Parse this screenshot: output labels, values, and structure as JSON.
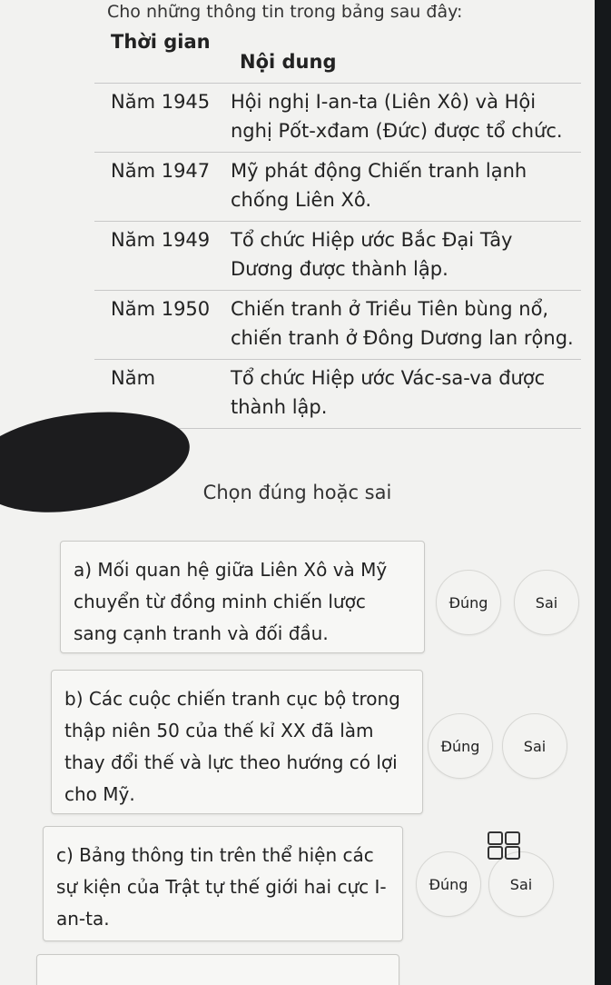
{
  "intro_text": "Cho những thông tin trong bảng sau đây:",
  "table": {
    "headers": [
      "Thời gian",
      "Nội dung"
    ],
    "rows": [
      {
        "year": "Năm 1945",
        "content": "Hội nghị I-an-ta (Liên Xô) và Hội nghị Pốt-xđam (Đức) được tổ chức."
      },
      {
        "year": "Năm 1947",
        "content": "Mỹ phát động Chiến tranh lạnh chống Liên Xô."
      },
      {
        "year": "Năm 1949",
        "content": "Tổ chức Hiệp ước Bắc Đại Tây Dương được thành lập."
      },
      {
        "year": "Năm 1950",
        "content": "Chiến tranh ở Triều Tiên bùng nổ, chiến tranh ở Đông Dương lan rộng."
      },
      {
        "year": "Năm",
        "content": "Tổ chức Hiệp ước Vác-sa-va được thành lập."
      }
    ]
  },
  "section_heading": "Chọn đúng hoặc sai",
  "questions": [
    {
      "text": "a) Mối quan hệ giữa Liên Xô và Mỹ chuyển từ đồng minh chiến lược sang cạnh tranh và đối đầu.",
      "true_label": "Đúng",
      "false_label": "Sai"
    },
    {
      "text": "b) Các cuộc chiến tranh cục bộ trong thập niên 50 của thế kỉ XX đã làm thay đổi thế và lực theo hướng có lợi cho Mỹ.",
      "true_label": "Đúng",
      "false_label": "Sai"
    },
    {
      "text": "c) Bảng thông tin trên thể hiện các sự kiện của Trật tự thế giới hai cực I-an-ta.",
      "true_label": "Đúng",
      "false_label": "Sai"
    }
  ],
  "icons": {
    "grid": "grid-view-icon"
  }
}
